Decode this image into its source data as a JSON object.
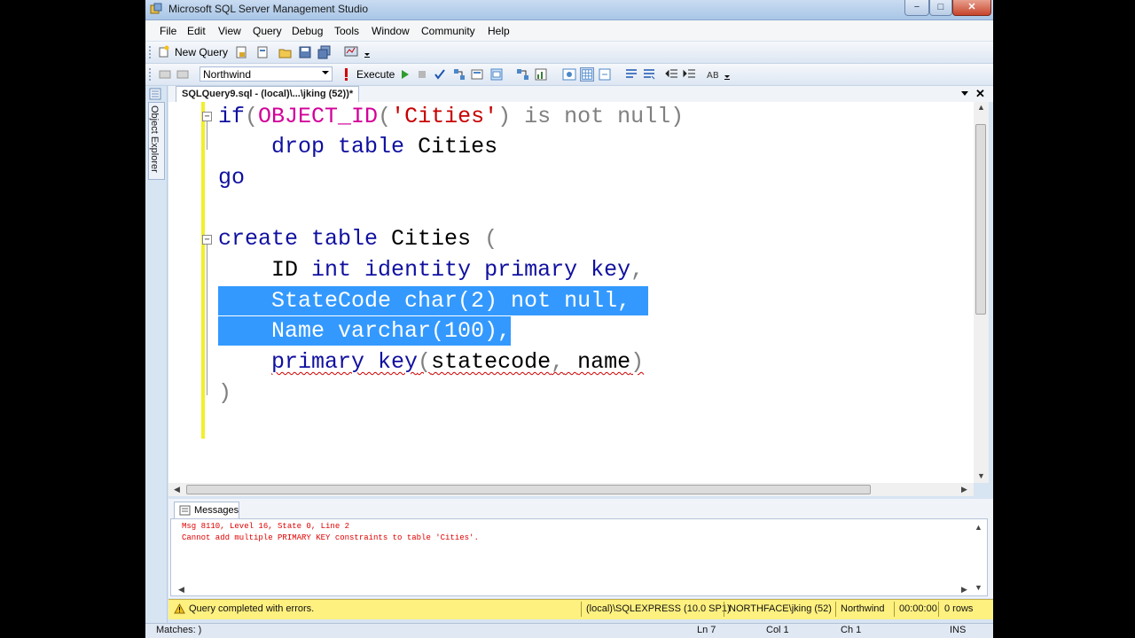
{
  "window": {
    "title": "Microsoft SQL Server Management Studio",
    "minimize": "−",
    "maximize": "□",
    "close": "✕"
  },
  "menu": [
    "File",
    "Edit",
    "View",
    "Query",
    "Debug",
    "Tools",
    "Window",
    "Community",
    "Help"
  ],
  "toolbar": {
    "new_query": "New Query",
    "database": "Northwind",
    "execute": "Execute"
  },
  "sidebar": {
    "object_explorer": "Object Explorer"
  },
  "document_tab": {
    "title": "SQLQuery9.sql - (local)\\...\\jking (52))*"
  },
  "code": {
    "l1_kw": "if",
    "l1_paren": "(",
    "l1_fn": "OBJECT_ID",
    "l1_paren2": "(",
    "l1_str": "'Cities'",
    "l1_rest": ") is not null)",
    "l2_kw": "drop table",
    "l2_tx": "Cities",
    "l3_kw": "go",
    "l5_kw": "create table",
    "l5_tx": "Cities",
    "l5_gr": "(",
    "l6_tx": "ID",
    "l6_kw": "int identity primary key",
    "l6_gr": ",",
    "l7_sel": "StateCode char(2) not null,",
    "l8_sel": "Name varchar(100),",
    "l9_kw": "primary key",
    "l9_gr1": "(",
    "l9_tx1": "statecode",
    "l9_gr2": ",",
    "l9_tx2": "name",
    "l9_gr3": ")",
    "l10_gr": ")"
  },
  "messages": {
    "tab": "Messages",
    "line1": "Msg 8110, Level 16, State 0, Line 2",
    "line2": "Cannot add multiple PRIMARY KEY constraints to table 'Cities'."
  },
  "status": {
    "text": "Query completed with errors.",
    "server": "(local)\\SQLEXPRESS (10.0 SP1)",
    "user": "NORTHFACE\\jking (52)",
    "db": "Northwind",
    "time": "00:00:00",
    "rows": "0 rows"
  },
  "bottom": {
    "matches": "Matches: )",
    "ln": "Ln 7",
    "col": "Col 1",
    "ch": "Ch 1",
    "ins": "INS"
  },
  "colors": {
    "keyword": "#1010a0",
    "function": "#d20099",
    "string": "#c80000",
    "selection": "#3399ff",
    "error_text": "#e00000",
    "status_bar": "#fff180"
  }
}
